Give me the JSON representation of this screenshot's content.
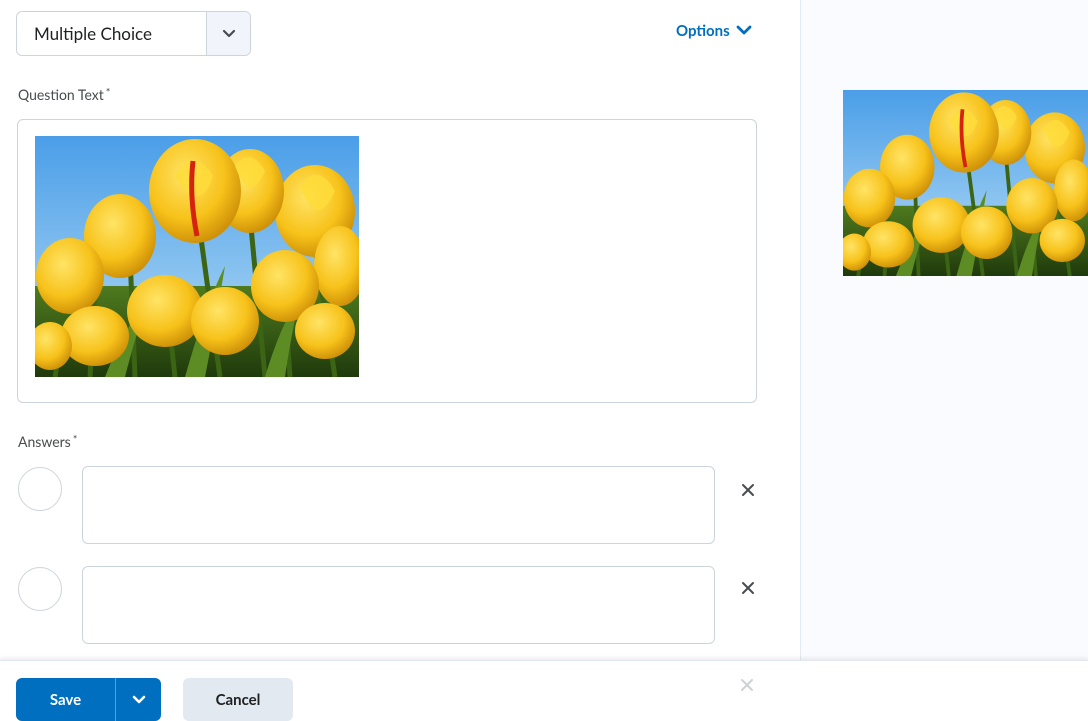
{
  "question_type": {
    "selected": "Multiple Choice",
    "icon": "chevron-down-icon"
  },
  "options": {
    "label": "Options",
    "icon": "chevron-down-icon",
    "color": "#006fbf"
  },
  "question_text": {
    "label": "Question Text",
    "required_marker": "*",
    "image": "tulip-field-photo"
  },
  "answers": {
    "label": "Answers",
    "required_marker": "*",
    "items": [
      {
        "value": "",
        "remove_icon": "close-icon"
      },
      {
        "value": "",
        "remove_icon": "close-icon"
      }
    ]
  },
  "preview": {
    "image": "tulip-field-photo"
  },
  "footer": {
    "save_label": "Save",
    "cancel_label": "Cancel",
    "accent": "#006fbf"
  }
}
